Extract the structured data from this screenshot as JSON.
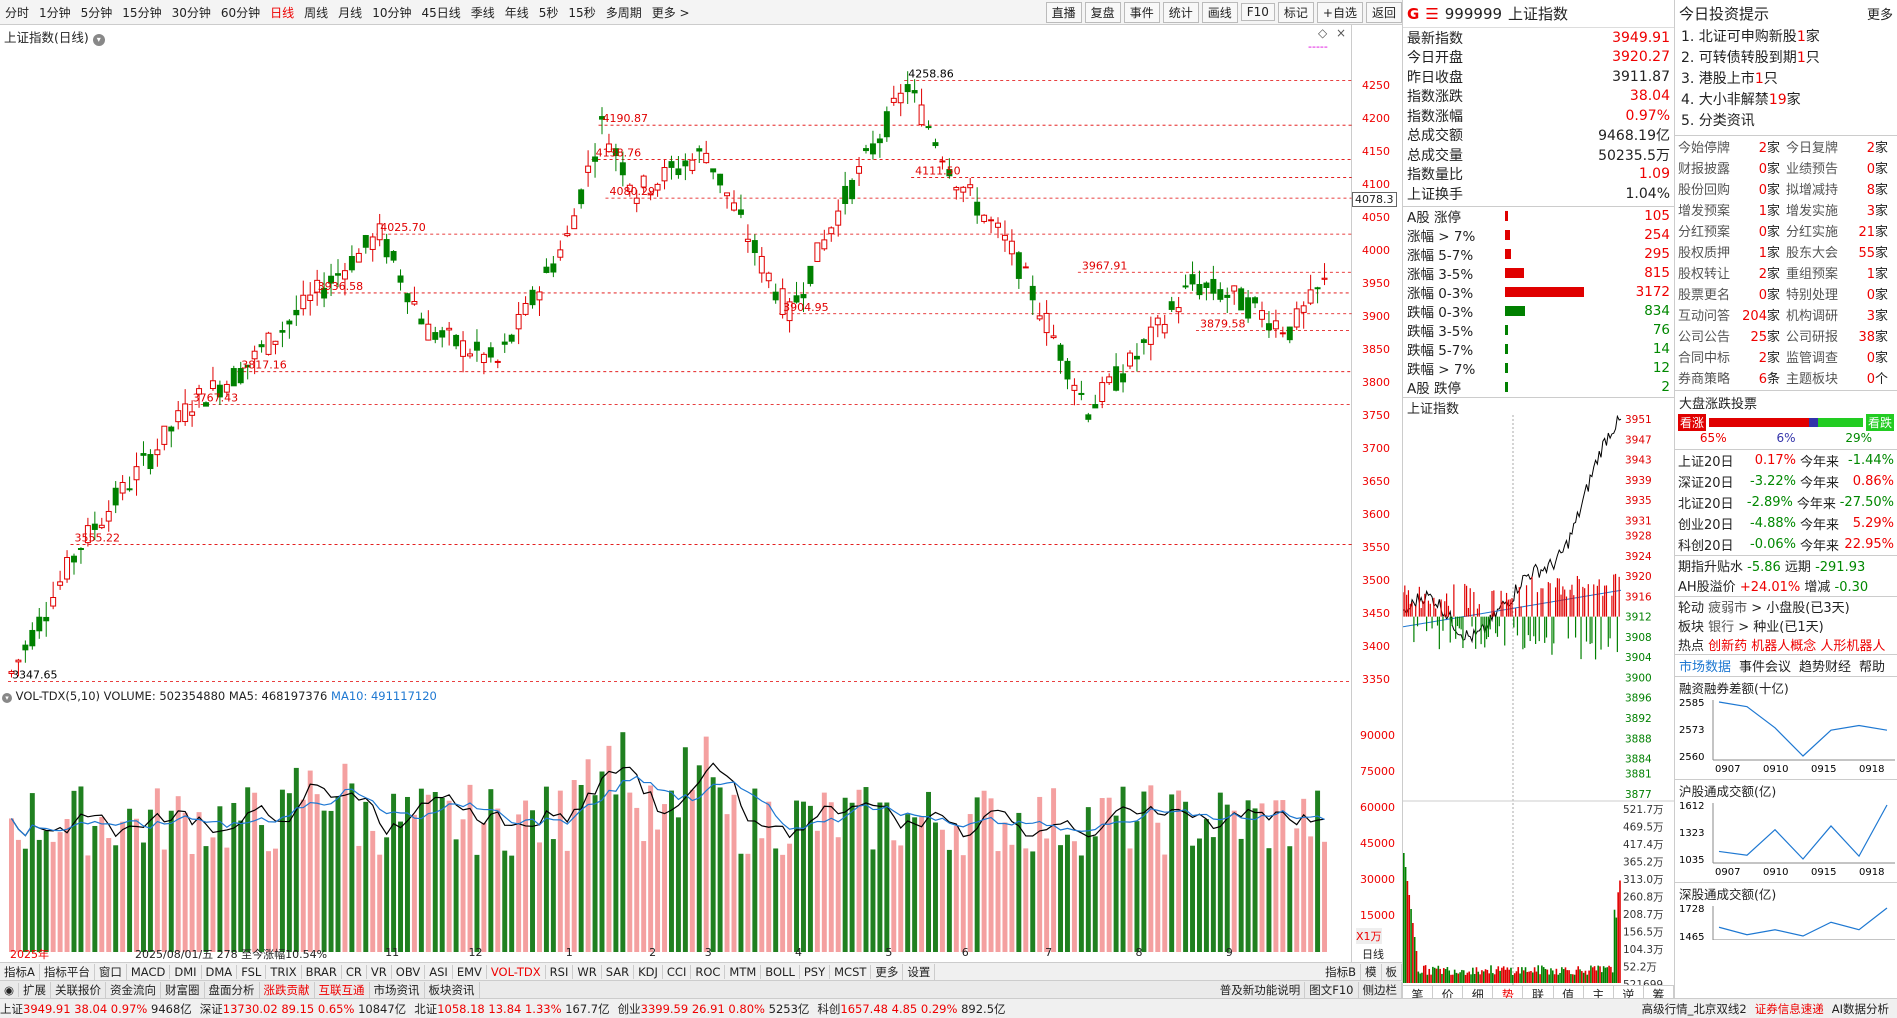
{
  "toolbar": {
    "periods": [
      "分时",
      "1分钟",
      "5分钟",
      "15分钟",
      "30分钟",
      "60分钟",
      "日线",
      "周线",
      "月线",
      "10分钟",
      "45日线",
      "季线",
      "年线",
      "5秒",
      "15秒",
      "多周期",
      "更多 >"
    ],
    "active_period": "日线",
    "right_buttons": [
      "直播",
      "复盘",
      "事件",
      "统计",
      "画线",
      "F10",
      "标记",
      "+自选",
      "返回"
    ]
  },
  "kchart": {
    "title": "上证指数(日线)",
    "ma_marker": "-----",
    "price_labels": [
      {
        "text": "4258.86",
        "p": 4258.86,
        "i": 129
      },
      {
        "text": "4190.87",
        "p": 4190.87,
        "i": 85
      },
      {
        "text": "4138.76",
        "p": 4138.76,
        "i": 84
      },
      {
        "text": "4111.50",
        "p": 4111.5,
        "i": 130
      },
      {
        "text": "4080.29",
        "p": 4080.29,
        "i": 86
      },
      {
        "text": "4025.70",
        "p": 4025.7,
        "i": 53
      },
      {
        "text": "3967.91",
        "p": 3967.91,
        "i": 154
      },
      {
        "text": "3936.58",
        "p": 3936.58,
        "i": 44
      },
      {
        "text": "3904.95",
        "p": 3904.95,
        "i": 111
      },
      {
        "text": "3879.58",
        "p": 3879.58,
        "i": 171
      },
      {
        "text": "3817.16",
        "p": 3817.16,
        "i": 33
      },
      {
        "text": "3767.43",
        "p": 3767.43,
        "i": 26
      },
      {
        "text": "3555.22",
        "p": 3555.22,
        "i": 9
      },
      {
        "text": "3347.65",
        "p": 3347.65,
        "i": 0
      }
    ],
    "last_price_tag": "4078.3",
    "y_ticks": [
      "4250",
      "4200",
      "4150",
      "4100",
      "4050",
      "4000",
      "3950",
      "3900",
      "3850",
      "3800",
      "3750",
      "3700",
      "3650",
      "3600",
      "3550",
      "3500",
      "3450",
      "3400",
      "3350"
    ],
    "x_labels": [
      {
        "text": "2025年",
        "i": 0
      },
      {
        "text": "2025/08/01/五 278 至今涨幅10.54%",
        "i": 18
      },
      {
        "text": "11",
        "i": 54
      },
      {
        "text": "12",
        "i": 66
      },
      {
        "text": "1",
        "i": 80
      },
      {
        "text": "2",
        "i": 92
      },
      {
        "text": "3",
        "i": 100
      },
      {
        "text": "4",
        "i": 113
      },
      {
        "text": "5",
        "i": 126
      },
      {
        "text": "6",
        "i": 137
      },
      {
        "text": "7",
        "i": 149
      },
      {
        "text": "8",
        "i": 162
      },
      {
        "text": "9",
        "i": 175
      }
    ],
    "x_axis_right": "日线"
  },
  "vol": {
    "title": "VOL-TDX(5,10)",
    "volume_label": "VOLUME: 502354880",
    "ma5_label": "MA5: 468197376",
    "ma10_label": "MA10: 491117120",
    "y_ticks": [
      "90000",
      "75000",
      "60000",
      "45000",
      "30000",
      "15000"
    ],
    "unit": "X1万"
  },
  "bottom_bar": [
    "指标A",
    "指标平台",
    "窗口",
    "MACD",
    "DMI",
    "DMA",
    "FSL",
    "TRIX",
    "BRAR",
    "CR",
    "VR",
    "OBV",
    "ASI",
    "EMV",
    "VOL-TDX",
    "RSI",
    "WR",
    "SAR",
    "KDJ",
    "CCI",
    "ROC",
    "MTM",
    "BOLL",
    "PSY",
    "MCST",
    "更多",
    "设置"
  ],
  "bottom_bar_active": "VOL-TDX",
  "bottom_right": [
    "指标B",
    "模",
    "板"
  ],
  "tab_row": [
    "扩展",
    "关联报价",
    "资金流向",
    "财富圈",
    "盘面分析",
    "涨跌贡献",
    "互联互通",
    "市场资讯",
    "板块资讯"
  ],
  "tab_row_hl": [
    "涨跌贡献",
    "互联互通"
  ],
  "tab_row_right": [
    "普及新功能说明",
    "图文F10",
    "侧边栏"
  ],
  "quote": {
    "code": "999999",
    "name": "上证指数",
    "rows": [
      {
        "k": "最新指数",
        "v": "3949.91",
        "c": "up"
      },
      {
        "k": "今日开盘",
        "v": "3920.27",
        "c": "up"
      },
      {
        "k": "昨日收盘",
        "v": "3911.87",
        "c": ""
      },
      {
        "k": "指数涨跌",
        "v": "38.04",
        "c": "up"
      },
      {
        "k": "指数涨幅",
        "v": "0.97%",
        "c": "up"
      },
      {
        "k": "总成交额",
        "v": "9468.19亿",
        "c": ""
      },
      {
        "k": "总成交量",
        "v": "50235.5万",
        "c": ""
      },
      {
        "k": "指数量比",
        "v": "1.09",
        "c": "up"
      },
      {
        "k": "上证换手",
        "v": "1.04%",
        "c": ""
      }
    ]
  },
  "dist": [
    {
      "k": "A股 涨停",
      "v": "105",
      "w": 0.02,
      "c": "up"
    },
    {
      "k": "涨幅 > 7%",
      "v": "254",
      "w": 0.05,
      "c": "up"
    },
    {
      "k": "涨幅 5-7%",
      "v": "295",
      "w": 0.06,
      "c": "up"
    },
    {
      "k": "涨幅 3-5%",
      "v": "815",
      "w": 0.18,
      "c": "up"
    },
    {
      "k": "涨幅 0-3%",
      "v": "3172",
      "w": 0.75,
      "c": "up"
    },
    {
      "k": "跌幅 0-3%",
      "v": "834",
      "w": 0.19,
      "c": "dn"
    },
    {
      "k": "跌幅 3-5%",
      "v": "76",
      "w": 0.02,
      "c": "dn"
    },
    {
      "k": "跌幅 5-7%",
      "v": "14",
      "w": 0.005,
      "c": "dn"
    },
    {
      "k": "跌幅 > 7%",
      "v": "12",
      "w": 0.005,
      "c": "dn"
    },
    {
      "k": "A股 跌停",
      "v": "2",
      "w": 0.003,
      "c": "dn"
    }
  ],
  "intraday": {
    "title": "上证指数",
    "y_ticks": [
      "3951",
      "3947",
      "3943",
      "3939",
      "3935",
      "3931",
      "3928",
      "3924",
      "3920",
      "3916",
      "3912",
      "3908",
      "3904",
      "3900",
      "3896",
      "3892",
      "3888",
      "3884",
      "3881",
      "3877"
    ],
    "vol_ticks": [
      "521.7万",
      "469.5万",
      "417.4万",
      "365.2万",
      "313.0万",
      "260.8万",
      "208.7万",
      "156.5万",
      "104.3万",
      "52.2万",
      "521699"
    ],
    "tabs": [
      "笔",
      "价",
      "细",
      "势",
      "联",
      "值",
      "主",
      "逆",
      "筹"
    ],
    "active_tab": "势"
  },
  "tips": {
    "title": "今日投资提示",
    "more": "更多",
    "items": [
      {
        "pre": "1. 北证可申购新股",
        "num": "1",
        "suf": "家"
      },
      {
        "pre": "2. 可转债转股到期",
        "num": "1",
        "suf": "只"
      },
      {
        "pre": "3. 港股上市",
        "num": "1",
        "suf": "只"
      },
      {
        "pre": "4. 大小非解禁",
        "num": "19",
        "suf": "家"
      },
      {
        "pre": "5. 分类资讯",
        "num": "",
        "suf": ""
      }
    ]
  },
  "events": [
    [
      "今始停牌",
      "2",
      "家",
      "今日复牌",
      "2",
      "家"
    ],
    [
      "财报披露",
      "0",
      "家",
      "业绩预告",
      "0",
      "家"
    ],
    [
      "股份回购",
      "0",
      "家",
      "拟增减持",
      "8",
      "家"
    ],
    [
      "增发预案",
      "1",
      "家",
      "增发实施",
      "3",
      "家"
    ],
    [
      "分红预案",
      "0",
      "家",
      "分红实施",
      "21",
      "家"
    ],
    [
      "股权质押",
      "1",
      "家",
      "股东大会",
      "55",
      "家"
    ],
    [
      "股权转让",
      "2",
      "家",
      "重组预案",
      "1",
      "家"
    ],
    [
      "股票更名",
      "0",
      "家",
      "特别处理",
      "0",
      "家"
    ],
    [
      "互动问答",
      "204",
      "家",
      "机构调研",
      "3",
      "家"
    ],
    [
      "公司公告",
      "25",
      "家",
      "公司研报",
      "38",
      "家"
    ],
    [
      "合同中标",
      "2",
      "家",
      "监管调查",
      "0",
      "家"
    ],
    [
      "券商策略",
      "6",
      "条",
      "主题板块",
      "0",
      "个"
    ]
  ],
  "vote": {
    "title": "大盘涨跌投票",
    "bull": "看涨",
    "bear": "看跌",
    "p_up": "65%",
    "p_flat": "6%",
    "p_down": "29%",
    "up": 0.65,
    "flat": 0.06,
    "down": 0.29
  },
  "perf": [
    {
      "k": "上证20日",
      "v": "0.17%",
      "c": "up",
      "k2": "今年来",
      "v2": "-1.44%",
      "c2": "dn"
    },
    {
      "k": "深证20日",
      "v": "-3.22%",
      "c": "dn",
      "k2": "今年来",
      "v2": "0.86%",
      "c2": "up"
    },
    {
      "k": "北证20日",
      "v": "-2.89%",
      "c": "dn",
      "k2": "今年来",
      "v2": "-27.50%",
      "c2": "dn"
    },
    {
      "k": "创业20日",
      "v": "-4.88%",
      "c": "dn",
      "k2": "今年来",
      "v2": "5.29%",
      "c2": "up"
    },
    {
      "k": "科创20日",
      "v": "-0.06%",
      "c": "dn",
      "k2": "今年来",
      "v2": "22.95%",
      "c2": "up"
    }
  ],
  "futures": {
    "k1": "期指升贴水",
    "v1": "-5.86",
    "k2": "远期",
    "v2": "-291.93",
    "k3": "AH股溢价",
    "v3": "+24.01%",
    "k4": "增减",
    "v4": "-0.30"
  },
  "rotation": {
    "k1": "轮动",
    "a1": "疲弱市",
    "b1": "> 小盘股(已3天)",
    "k2": "板块",
    "a2": "银行",
    "b2": "> 种业(已1天)",
    "k3": "热点",
    "hot": [
      "创新药",
      "机器人概念",
      "人形机器人"
    ]
  },
  "market_tabs": [
    "市场数据",
    "事件会议",
    "趋势财经",
    "帮助"
  ],
  "minis": [
    {
      "title": "融资融券差额(十亿)",
      "ticks": [
        "2585",
        "2573",
        "2560"
      ],
      "x": [
        "0907",
        "0910",
        "0915",
        "0918"
      ],
      "vals": [
        2583,
        2581,
        2572,
        2560,
        2571,
        2573,
        2571
      ]
    },
    {
      "title": "沪股通成交额(亿)",
      "ticks": [
        "1612",
        "1323",
        "1035"
      ],
      "x": [
        "0907",
        "0910",
        "0915",
        "0918"
      ],
      "vals": [
        1120,
        1080,
        1350,
        1040,
        1390,
        1070,
        1612
      ]
    },
    {
      "title": "深股通成交额(亿)",
      "ticks": [
        "1728",
        "1465"
      ],
      "x": [],
      "vals": [
        1420,
        1300,
        1380,
        1280,
        1500,
        1380,
        1728
      ]
    }
  ],
  "status": [
    {
      "k": "上证",
      "v": "3949.91",
      "d": "38.04",
      "p": "0.97%",
      "a": "9468亿",
      "c": "up"
    },
    {
      "k": "深证",
      "v": "13730.02",
      "d": "89.15",
      "p": "0.65%",
      "a": "10847亿",
      "c": "up"
    },
    {
      "k": "北证",
      "v": "1058.18",
      "d": "13.84",
      "p": "1.33%",
      "a": "167.7亿",
      "c": "up"
    },
    {
      "k": "创业",
      "v": "3399.59",
      "d": "26.91",
      "p": "0.80%",
      "a": "5253亿",
      "c": "up"
    },
    {
      "k": "科创",
      "v": "1657.48",
      "d": "4.85",
      "p": "0.29%",
      "a": "892.5亿",
      "c": "up"
    }
  ],
  "status_right": [
    "高级行情_北京双线2",
    "证券信息速递",
    "AI数据分析"
  ],
  "colors": {
    "up": "#e00000",
    "down": "#008000",
    "ma5": "#000000",
    "ma10": "#1e78d2",
    "grid": "#e00000"
  }
}
